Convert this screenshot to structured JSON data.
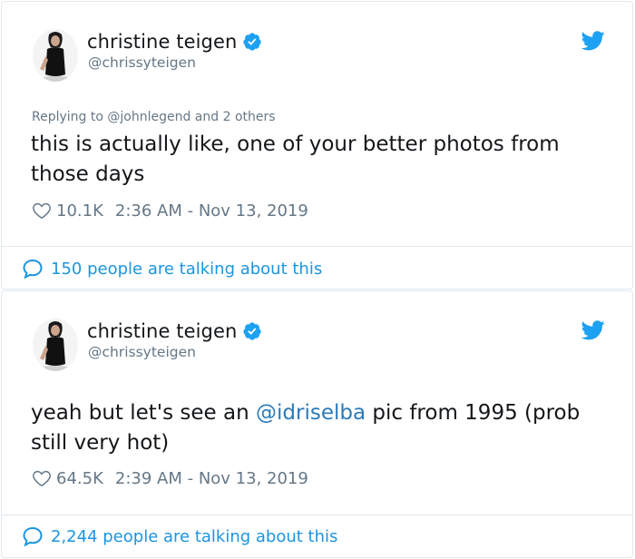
{
  "tweets": [
    {
      "name": "christine teigen",
      "handle": "@chrissyteigen",
      "replying_prefix": "Replying to ",
      "replying_to": "@johnlegend",
      "replying_suffix": " and 2 others",
      "text_before": "this is actually like, one of your better photos from those days",
      "mention": "",
      "text_after": "",
      "likes": "10.1K",
      "timestamp": "2:36 AM - Nov 13, 2019",
      "talking": "150 people are talking about this"
    },
    {
      "name": "christine teigen",
      "handle": "@chrissyteigen",
      "text_before": "yeah but let's see an ",
      "mention": "@idriselba",
      "text_after": " pic from 1995 (prob still very hot)",
      "likes": "64.5K",
      "timestamp": "2:39 AM - Nov 13, 2019",
      "talking": "2,244 people are talking about this"
    }
  ],
  "colors": {
    "link": "#1b95e0",
    "mention": "#2b7bb9",
    "muted": "#657786",
    "verified": "#1da1f2",
    "border": "#e1e8ed"
  },
  "icons": [
    "verified-badge-icon",
    "twitter-bird-icon",
    "heart-icon",
    "speech-bubble-icon"
  ]
}
